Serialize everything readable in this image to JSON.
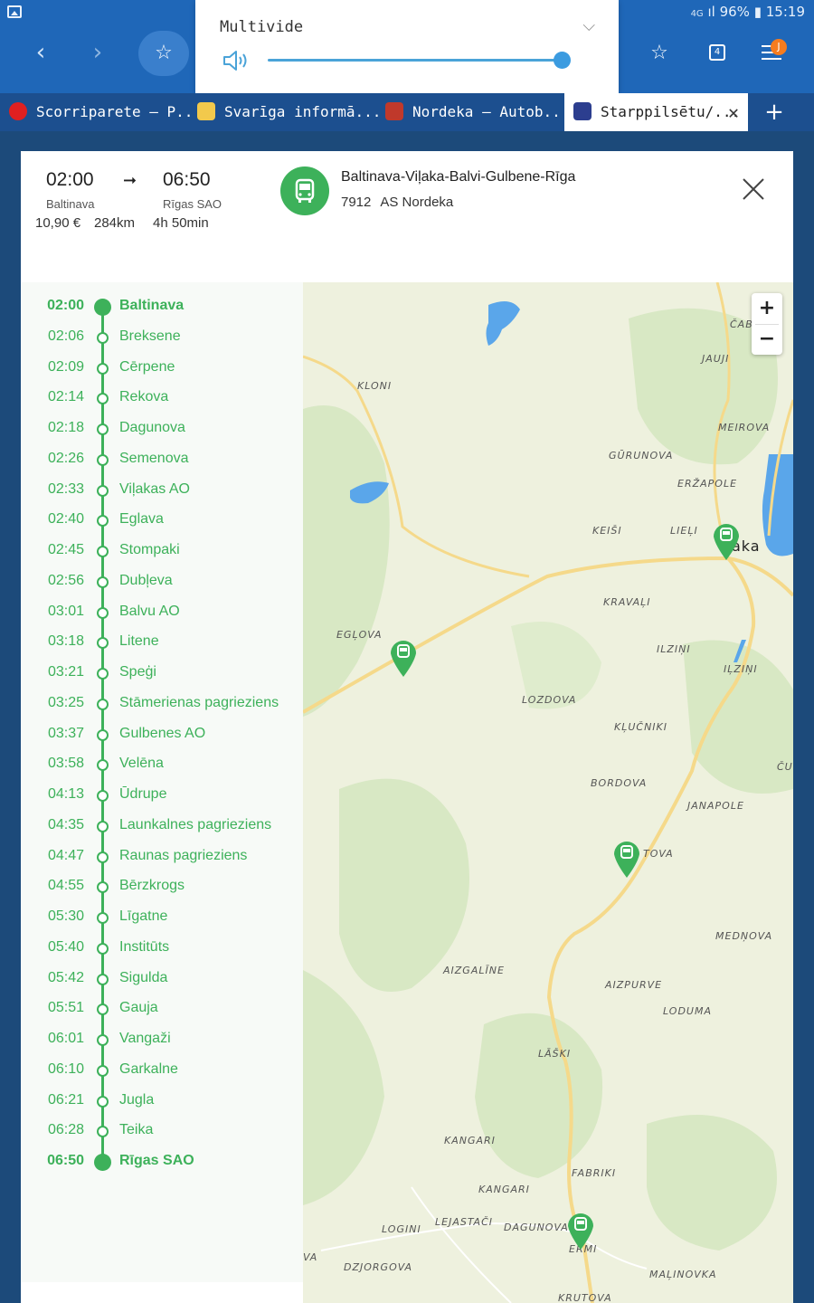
{
  "status_bar": {
    "network": "4G",
    "battery": "96%",
    "clock": "15:19"
  },
  "volume": {
    "title": "Multivide",
    "level": 1.0
  },
  "tabs": [
    {
      "label": "Scorriparete – P...",
      "color": "#e02020"
    },
    {
      "label": "Svarīga informā...",
      "color": "#f2c94c"
    },
    {
      "label": "Nordeka – Autob...",
      "color": "#c0392b"
    },
    {
      "label": "Starppilsētu/...",
      "color": "#2c3e8f"
    }
  ],
  "menu_badge": "J",
  "tabs_count": "4",
  "trip": {
    "dep_time": "02:00",
    "arr_time": "06:50",
    "dep_stop": "Baltinava",
    "arr_stop": "Rīgas SAO",
    "price": "10,90 €",
    "distance": "284km",
    "duration": "4h 50min",
    "route_name": "Baltinava-Viļaka-Balvi-Gulbene-Rīga",
    "route_number": "7912",
    "operator": "AS Nordeka"
  },
  "stops": [
    {
      "time": "02:00",
      "name": "Baltinava"
    },
    {
      "time": "02:06",
      "name": "Breksene"
    },
    {
      "time": "02:09",
      "name": "Cērpene"
    },
    {
      "time": "02:14",
      "name": "Rekova"
    },
    {
      "time": "02:18",
      "name": "Dagunova"
    },
    {
      "time": "02:26",
      "name": "Semenova"
    },
    {
      "time": "02:33",
      "name": "Viļakas AO"
    },
    {
      "time": "02:40",
      "name": "Eglava"
    },
    {
      "time": "02:45",
      "name": "Stompaki"
    },
    {
      "time": "02:56",
      "name": "Dubļeva"
    },
    {
      "time": "03:01",
      "name": "Balvu AO"
    },
    {
      "time": "03:18",
      "name": "Litene"
    },
    {
      "time": "03:21",
      "name": "Speģi"
    },
    {
      "time": "03:25",
      "name": "Stāmerienas pagrieziens"
    },
    {
      "time": "03:37",
      "name": "Gulbenes AO"
    },
    {
      "time": "03:58",
      "name": "Velēna"
    },
    {
      "time": "04:13",
      "name": "Ūdrupe"
    },
    {
      "time": "04:35",
      "name": "Launkalnes pagrieziens"
    },
    {
      "time": "04:47",
      "name": "Raunas pagrieziens"
    },
    {
      "time": "04:55",
      "name": "Bērzkrogs"
    },
    {
      "time": "05:30",
      "name": "Līgatne"
    },
    {
      "time": "05:40",
      "name": "Institūts"
    },
    {
      "time": "05:42",
      "name": "Sigulda"
    },
    {
      "time": "05:51",
      "name": "Gauja"
    },
    {
      "time": "06:01",
      "name": "Vangaži"
    },
    {
      "time": "06:10",
      "name": "Garkalne"
    },
    {
      "time": "06:21",
      "name": "Jugla"
    },
    {
      "time": "06:28",
      "name": "Teika"
    },
    {
      "time": "06:50",
      "name": "Rīgas SAO"
    }
  ],
  "map": {
    "zoom_in": "+",
    "zoom_out": "−",
    "places": [
      "ČABA",
      "JAUJI",
      "KLONI",
      "MEIROVA",
      "GŪRUNOVA",
      "ERŽAPOLE",
      "KEIŠI",
      "LIEĻI",
      "aka",
      "KRAVAĻI",
      "EGĻOVA",
      "ILZIŅI",
      "IĻZIŅI",
      "LOZDOVA",
      "KĻUČNIKI",
      "ČU",
      "BORDOVA",
      "JANAPOLE",
      "TOVA",
      "MEDŅOVA",
      "AIZGALĪNE",
      "AIZPURVE",
      "LODUMA",
      "LĀŠKI",
      "KANGARI",
      "FABRIKI",
      "KANGARI",
      "LOGINI",
      "LEJASTAČI",
      "DAGUNOVA",
      "ERMI",
      "VA",
      "DZJORGOVA",
      "MAĻINOVKA",
      "KRUTOVA"
    ]
  }
}
